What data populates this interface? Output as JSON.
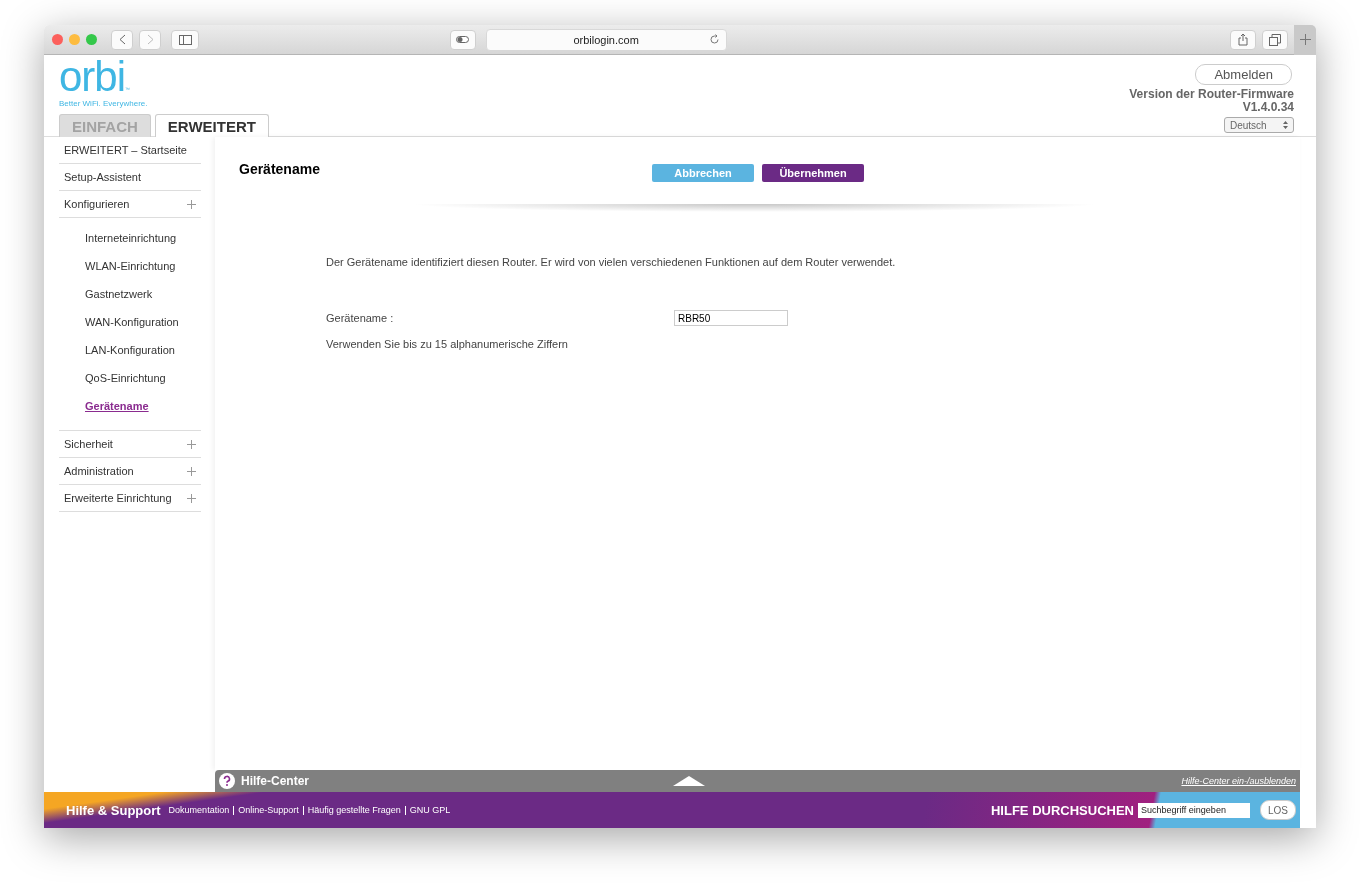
{
  "browser": {
    "url": "orbilogin.com"
  },
  "header": {
    "logo": "orbi",
    "logo_mark": "™",
    "tagline": "Better WiFi. Everywhere.",
    "logout": "Abmelden",
    "firmware_label": "Version der Router-Firmware",
    "firmware_version": "V1.4.0.34",
    "language": "Deutsch"
  },
  "tabs": [
    {
      "label": "EINFACH",
      "selected": false
    },
    {
      "label": "ERWEITERT",
      "selected": true
    }
  ],
  "sidebar": {
    "items": [
      {
        "kind": "link",
        "label": "ERWEITERT – Startseite"
      },
      {
        "kind": "link",
        "label": "Setup-Assistent"
      },
      {
        "kind": "group",
        "label": "Konfigurieren",
        "children": [
          {
            "label": "Interneteinrichtung",
            "selected": false
          },
          {
            "label": "WLAN-Einrichtung",
            "selected": false
          },
          {
            "label": "Gastnetzwerk",
            "selected": false
          },
          {
            "label": "WAN-Konfiguration",
            "selected": false
          },
          {
            "label": "LAN-Konfiguration",
            "selected": false
          },
          {
            "label": "QoS-Einrichtung",
            "selected": false
          },
          {
            "label": "Gerätename",
            "selected": true
          }
        ]
      },
      {
        "kind": "group",
        "label": "Sicherheit"
      },
      {
        "kind": "group",
        "label": "Administration"
      },
      {
        "kind": "group",
        "label": "Erweiterte Einrichtung"
      }
    ]
  },
  "page": {
    "title": "Gerätename",
    "cancel": "Abbrechen",
    "apply": "Übernehmen",
    "description": "Der Gerätename identifiziert diesen Router. Er wird von vielen verschiedenen Funktionen auf dem Router verwendet.",
    "field_label": "Gerätename :",
    "field_value": "RBR50",
    "hint": "Verwenden Sie bis zu 15 alphanumerische Ziffern"
  },
  "help_center": {
    "title": "Hilfe-Center",
    "toggle": "Hilfe-Center ein-/ausblenden"
  },
  "footer": {
    "title": "Hilfe & Support",
    "links": [
      "Dokumentation",
      "Online-Support",
      "Häufig gestellte Fragen",
      "GNU GPL"
    ],
    "search_label": "HILFE DURCHSUCHEN",
    "search_placeholder": "Suchbegriff eingeben",
    "search_button": "LOS"
  }
}
